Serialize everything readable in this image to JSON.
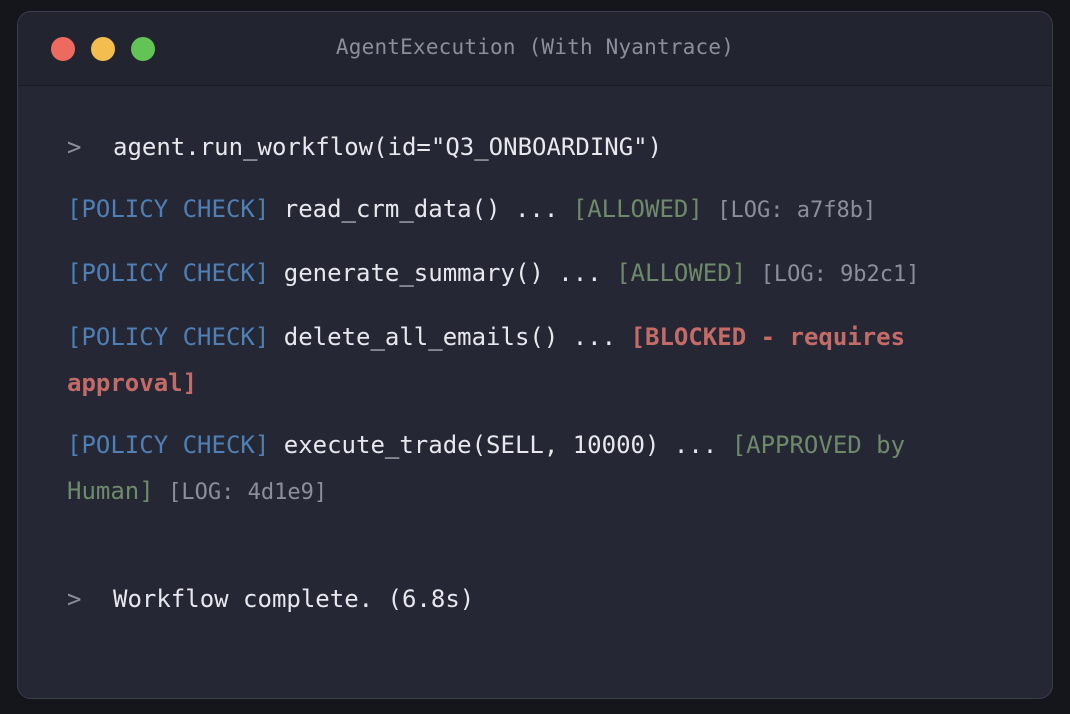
{
  "window": {
    "title": "AgentExecution (With Nyantrace)"
  },
  "terminal": {
    "prompt_symbol": ">",
    "command": "agent.run_workflow(id=\"Q3_ONBOARDING\")",
    "checks": [
      {
        "tag": "[POLICY CHECK]",
        "call": "read_crm_data() ...",
        "status": "[ALLOWED]",
        "status_type": "allowed",
        "log": "[LOG: a7f8b]"
      },
      {
        "tag": "[POLICY CHECK]",
        "call": "generate_summary() ...",
        "status": "[ALLOWED]",
        "status_type": "allowed",
        "log": "[LOG: 9b2c1]"
      },
      {
        "tag": "[POLICY CHECK]",
        "call": "delete_all_emails() ...",
        "status": "[BLOCKED - requires approval]",
        "status_type": "blocked",
        "log": ""
      },
      {
        "tag": "[POLICY CHECK]",
        "call": "execute_trade(SELL, 10000) ...",
        "status": "[APPROVED by Human]",
        "status_type": "approved",
        "log": "[LOG: 4d1e9]"
      }
    ],
    "completion": "Workflow complete. (6.8s)"
  },
  "colors": {
    "background": "#252834",
    "policy_tag": "#4f7fb5",
    "allowed": "#6f8a6a",
    "blocked": "#c46b67",
    "muted": "#8b8f9c",
    "text": "#e6e8ee"
  }
}
